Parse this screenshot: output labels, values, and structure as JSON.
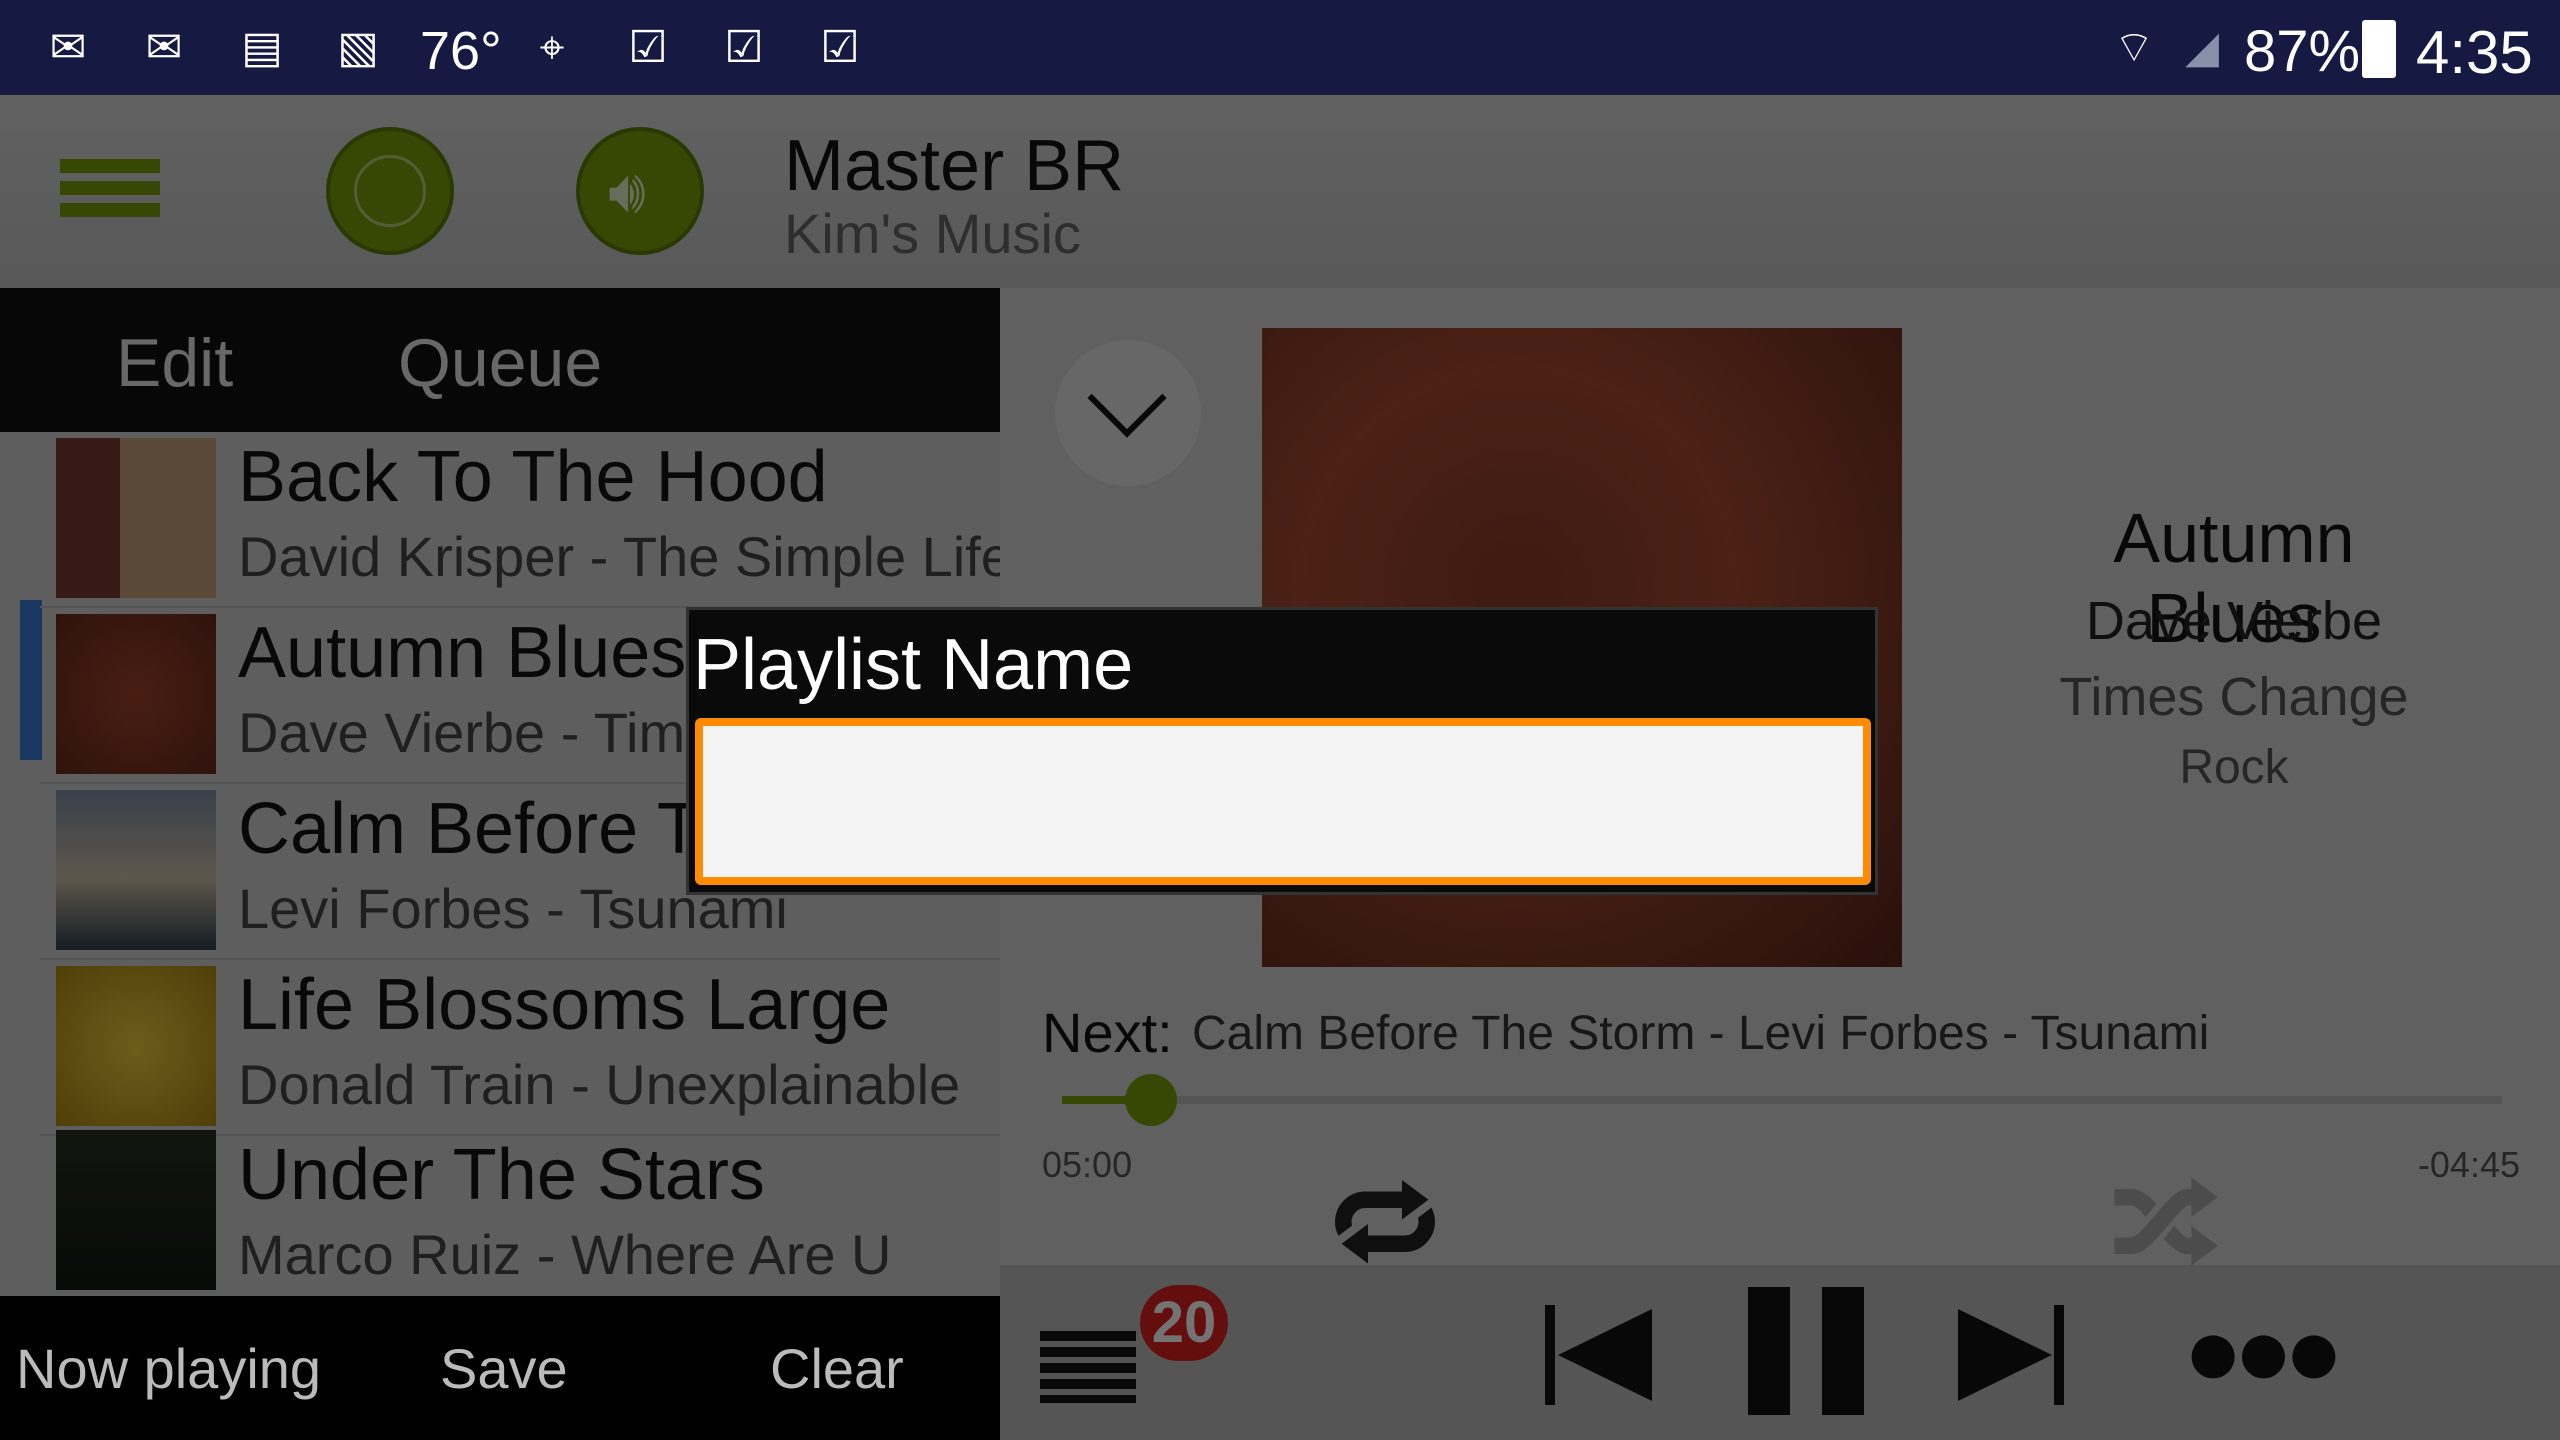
{
  "status_bar": {
    "temperature": "76°",
    "battery": "87%",
    "time": "4:35",
    "icons": [
      "email-icon",
      "email-icon",
      "message-icon",
      "image-icon",
      "maps-icon",
      "clipboard-check-icon",
      "clipboard-check-icon",
      "clipboard-check-icon",
      "wifi-icon",
      "signal-icon",
      "battery-icon"
    ]
  },
  "header": {
    "title": "Master BR",
    "subtitle": "Kim's Music",
    "accent": "#7a9e0a"
  },
  "left": {
    "tabs": [
      "Edit",
      "Queue"
    ],
    "tracks": [
      {
        "title": "Back To The Hood",
        "subtitle": "David Krisper - The Simple Life"
      },
      {
        "title": "Autumn Blues",
        "subtitle": "Dave Vierbe - Times Change",
        "current": true
      },
      {
        "title": "Calm Before The Storm",
        "subtitle": "Levi Forbes - Tsunami"
      },
      {
        "title": "Life Blossoms Large",
        "subtitle": "Donald Train - Unexplainable"
      },
      {
        "title": "Under The Stars",
        "subtitle": "Marco Ruiz - Where Are U"
      }
    ],
    "bottom": {
      "now_playing": "Now playing",
      "save": "Save",
      "clear": "Clear"
    }
  },
  "now_playing": {
    "title": "Autumn Blues",
    "artist": "Dave Vierbe",
    "album": "Times Change",
    "genre": "Rock",
    "next_label": "Next:",
    "next_value": "Calm Before The Storm - Levi Forbes - Tsunami",
    "elapsed": "05:00",
    "remaining": "-04:45",
    "progress": 0.03,
    "queue_count": "20"
  },
  "dialog": {
    "title": "Playlist Name",
    "value": "",
    "accent": "#ff8c00"
  }
}
